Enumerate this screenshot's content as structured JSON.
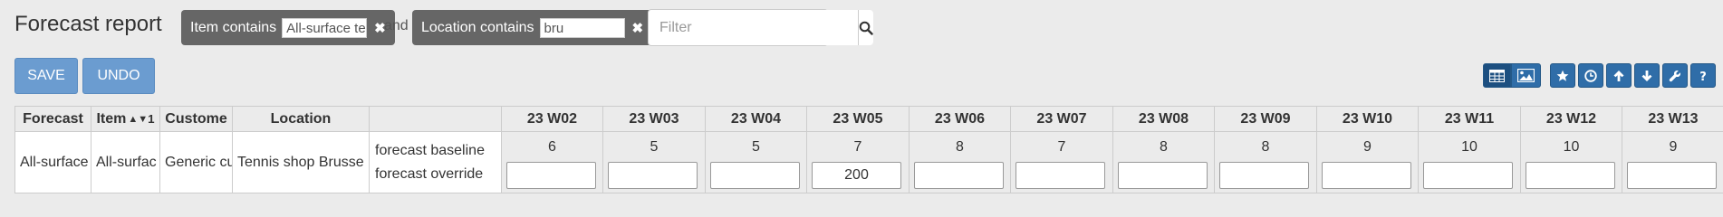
{
  "page": {
    "title": "Forecast report"
  },
  "filters": {
    "chips": [
      {
        "label": "Item contains",
        "value": "All-surface te"
      },
      {
        "label": "Location contains",
        "value": "bru"
      }
    ],
    "conjunction": "and",
    "search_placeholder": "Filter"
  },
  "toolbar": {
    "save_label": "SAVE",
    "undo_label": "UNDO"
  },
  "toolbar_icons": [
    "table-icon",
    "image-icon",
    "star-icon",
    "clock-icon",
    "arrow-up-icon",
    "arrow-down-icon",
    "wrench-icon",
    "question-icon"
  ],
  "grid": {
    "columns": [
      "Forecast",
      "Item",
      "Custome",
      "Location",
      ""
    ],
    "item_sort_order": "1",
    "weeks": [
      "23 W02",
      "23 W03",
      "23 W04",
      "23 W05",
      "23 W06",
      "23 W07",
      "23 W08",
      "23 W09",
      "23 W10",
      "23 W11",
      "23 W12",
      "23 W13"
    ],
    "row": {
      "forecast": "All-surface",
      "item": "All-surfac",
      "customer": "Generic cu",
      "location": "Tennis shop Brusse",
      "label_baseline": "forecast baseline",
      "label_override": "forecast override",
      "baseline": [
        "6",
        "5",
        "5",
        "7",
        "8",
        "7",
        "8",
        "8",
        "9",
        "10",
        "10",
        "9"
      ],
      "override": [
        "",
        "",
        "",
        "200",
        "",
        "",
        "",
        "",
        "",
        "",
        "",
        ""
      ]
    }
  },
  "colors": {
    "button": "#6b9cd0",
    "tool_button": "#2f6da8",
    "chip": "#666666",
    "background": "#ebebeb"
  }
}
